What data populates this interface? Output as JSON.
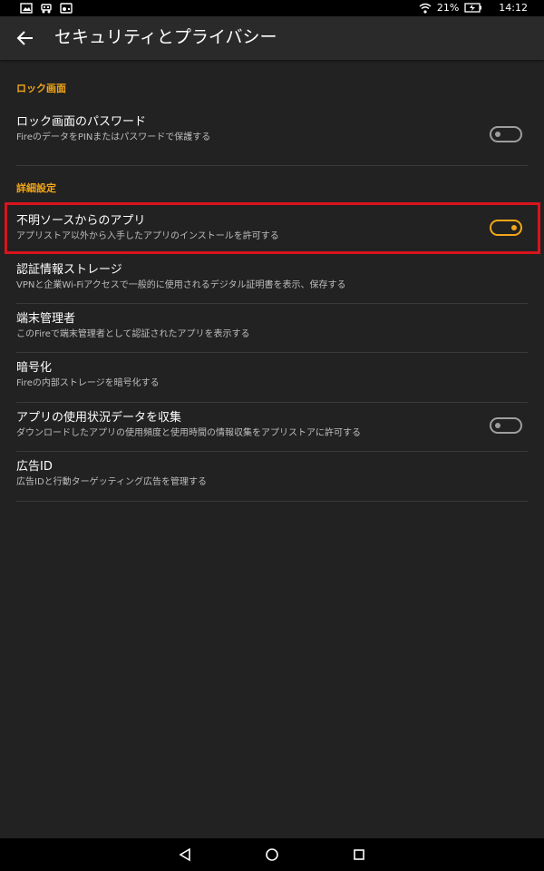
{
  "status_bar": {
    "icons_left": [
      "image-icon",
      "robot-icon",
      "cast-icon"
    ],
    "wifi_icon": "wifi-icon",
    "battery_percent": "21%",
    "battery_icon": "battery-charging-icon",
    "time": "14:12"
  },
  "app_bar": {
    "back_icon": "back-arrow-icon",
    "title": "セキュリティとプライバシー"
  },
  "sections": {
    "lock_screen": {
      "header": "ロック画面",
      "items": [
        {
          "title": "ロック画面のパスワード",
          "subtitle": "FireのデータをPINまたはパスワードで保護する",
          "toggle": "off"
        }
      ]
    },
    "advanced": {
      "header": "詳細設定",
      "items": [
        {
          "title": "不明ソースからのアプリ",
          "subtitle": "アプリストア以外から入手したアプリのインストールを許可する",
          "toggle": "on"
        },
        {
          "title": "認証情報ストレージ",
          "subtitle": "VPNと企業Wi-Fiアクセスで一般的に使用されるデジタル証明書を表示、保存する"
        },
        {
          "title": "端末管理者",
          "subtitle": "このFireで端末管理者として認証されたアプリを表示する"
        },
        {
          "title": "暗号化",
          "subtitle": "Fireの内部ストレージを暗号化する"
        },
        {
          "title": "アプリの使用状況データを収集",
          "subtitle": "ダウンロードしたアプリの使用頻度と使用時間の情報収集をアプリストアに許可する",
          "toggle": "off"
        },
        {
          "title": "広告ID",
          "subtitle": "広告IDと行動ターゲッティング広告を管理する"
        }
      ]
    }
  },
  "colors": {
    "accent": "#f2a618",
    "highlight_border": "#d9141c",
    "background": "#222222"
  },
  "nav_bar": {
    "back_icon": "nav-back-icon",
    "home_icon": "nav-home-icon",
    "recents_icon": "nav-recents-icon"
  }
}
